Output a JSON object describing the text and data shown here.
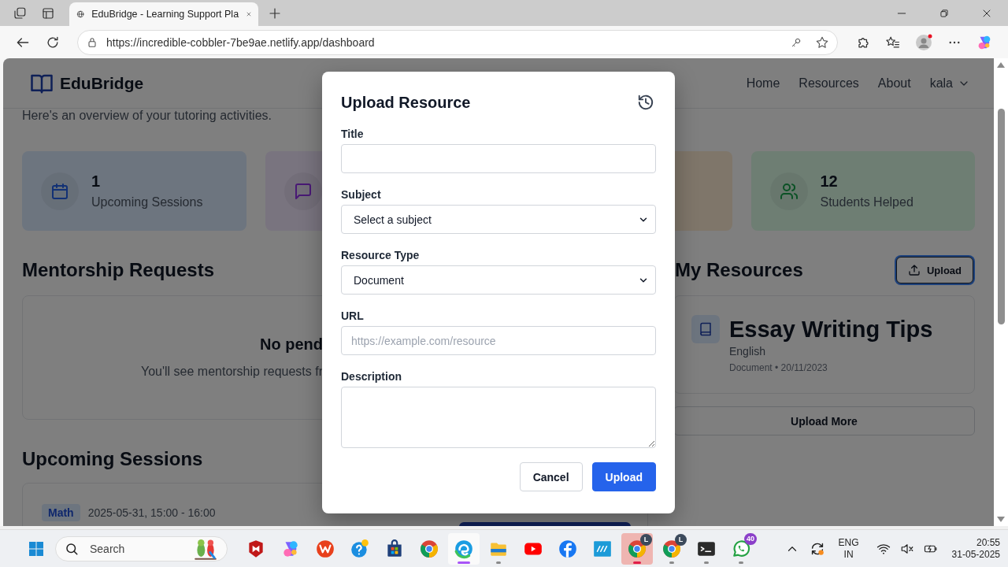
{
  "browser": {
    "tabs": [
      {
        "title": "EduBridge - Learning Support Pla",
        "selected": true
      }
    ],
    "url": "https://incredible-cobbler-7be9ae.netlify.app/dashboard"
  },
  "app": {
    "brand": "EduBridge",
    "nav": [
      {
        "label": "Home"
      },
      {
        "label": "Resources"
      },
      {
        "label": "About"
      }
    ],
    "user": "kala",
    "intro": "Here's an overview of your tutoring activities.",
    "stats": [
      {
        "kind": "calendar",
        "value": "1",
        "label": "Upcoming Sessions"
      },
      {
        "kind": "chat"
      },
      {
        "kind": "plain"
      },
      {
        "kind": "users",
        "value": "12",
        "label": "Students Helped"
      }
    ],
    "mentorship": {
      "title": "Mentorship Requests",
      "empty_title": "No pend",
      "empty_text": "You'll see mentorship requests fr"
    },
    "sessions": {
      "title": "Upcoming Sessions",
      "items": [
        {
          "subject": "Math",
          "time": "2025-05-31, 15:00 - 16:00",
          "has_action": true
        }
      ]
    },
    "resources": {
      "title": "My Resources",
      "upload": "Upload",
      "items": [
        {
          "title": "Essay Writing Tips",
          "subject": "English",
          "meta": "Document • 20/11/2023"
        }
      ],
      "more": "Upload More"
    }
  },
  "modal": {
    "title": "Upload Resource",
    "fields": [
      {
        "kind": "text",
        "label": "Title"
      },
      {
        "kind": "select",
        "label": "Subject",
        "value": "Select a subject"
      },
      {
        "kind": "select",
        "label": "Resource Type",
        "value": "Document"
      },
      {
        "kind": "text",
        "label": "URL",
        "placeholder": "https://example.com/resource"
      },
      {
        "kind": "textarea",
        "label": "Description"
      }
    ],
    "buttons": [
      {
        "kind": "secondary",
        "label": "Cancel"
      },
      {
        "kind": "primary",
        "label": "Upload"
      }
    ]
  },
  "taskbar": {
    "search": "Search",
    "apps": [
      {
        "kind": "shield",
        "selected": false,
        "running": false,
        "attention": false
      },
      {
        "kind": "copilot",
        "selected": false,
        "running": false,
        "attention": false
      },
      {
        "kind": "wps",
        "selected": false,
        "running": false,
        "attention": false
      },
      {
        "kind": "help",
        "selected": false,
        "running": false,
        "attention": false
      },
      {
        "kind": "store",
        "selected": false,
        "running": false,
        "attention": false
      },
      {
        "kind": "chrome",
        "selected": false,
        "running": false,
        "attention": false
      },
      {
        "kind": "edge",
        "selected": true,
        "running": true,
        "attention": false
      },
      {
        "kind": "folder",
        "selected": false,
        "running": true,
        "attention": false
      },
      {
        "kind": "youtube",
        "selected": false,
        "running": false,
        "attention": false
      },
      {
        "kind": "facebook",
        "selected": false,
        "running": false,
        "attention": false
      },
      {
        "kind": "myhp",
        "selected": false,
        "running": false,
        "attention": false
      },
      {
        "kind": "chrome",
        "selected": false,
        "running": true,
        "attention": true,
        "badge": "L"
      },
      {
        "kind": "chrome",
        "selected": false,
        "running": true,
        "attention": false,
        "badge": "L"
      },
      {
        "kind": "terminal",
        "selected": false,
        "running": true,
        "attention": false
      },
      {
        "kind": "whatsapp",
        "selected": false,
        "running": true,
        "attention": false,
        "badge": "40"
      }
    ],
    "language": [
      "ENG",
      "IN"
    ],
    "time": "20:55",
    "date": "31-05-2025"
  }
}
